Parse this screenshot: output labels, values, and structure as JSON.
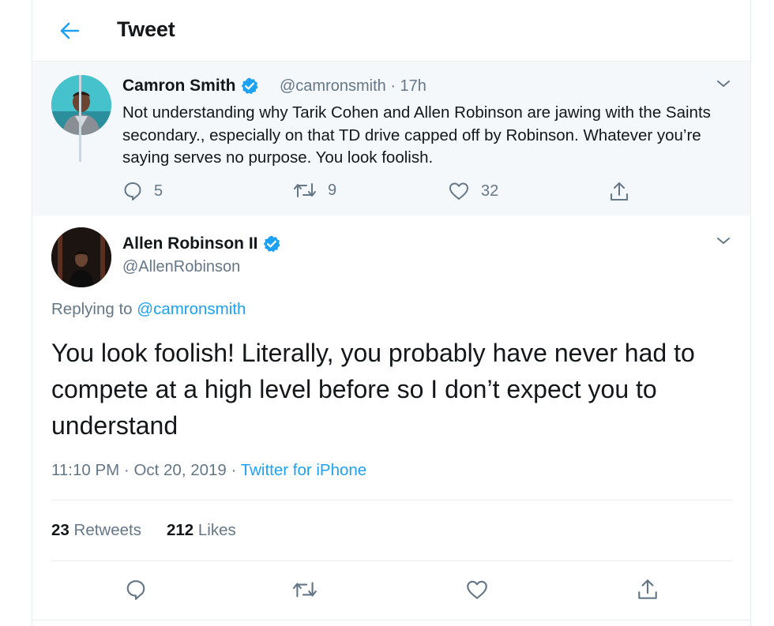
{
  "header": {
    "title": "Tweet"
  },
  "colors": {
    "accent": "#1da1f2",
    "secondary_text": "#657786",
    "primary_text": "#14171a",
    "parent_bg": "#f5f8fa"
  },
  "parent_tweet": {
    "name": "Camron Smith",
    "handle": "@camronsmith",
    "time": " · 17h",
    "text": "Not understanding why Tarik Cohen and Allen Robinson are jawing with the Saints secondary., especially on that TD drive capped off by Robinson. Whatever you’re saying serves no purpose. You look foolish.",
    "replies": "5",
    "retweets": "9",
    "likes": "32"
  },
  "main_tweet": {
    "name": "Allen Robinson II",
    "handle": "@AllenRobinson",
    "replying_prefix": "Replying to ",
    "replying_handle": "@camronsmith",
    "text": "You look foolish! Literally, you probably have never had to compete at a high level before so I don’t expect you to understand",
    "timestamp": "11:10 PM · Oct 20, 2019 · ",
    "source": "Twitter for iPhone",
    "retweet_count": "23",
    "retweet_label": " Retweets",
    "like_count": "212",
    "like_label": " Likes"
  },
  "icons": {
    "back": "arrow-left-icon",
    "verified": "verified-badge-icon",
    "chevron": "chevron-down-icon",
    "reply": "reply-icon",
    "retweet": "retweet-icon",
    "like": "heart-icon",
    "share": "share-icon"
  }
}
